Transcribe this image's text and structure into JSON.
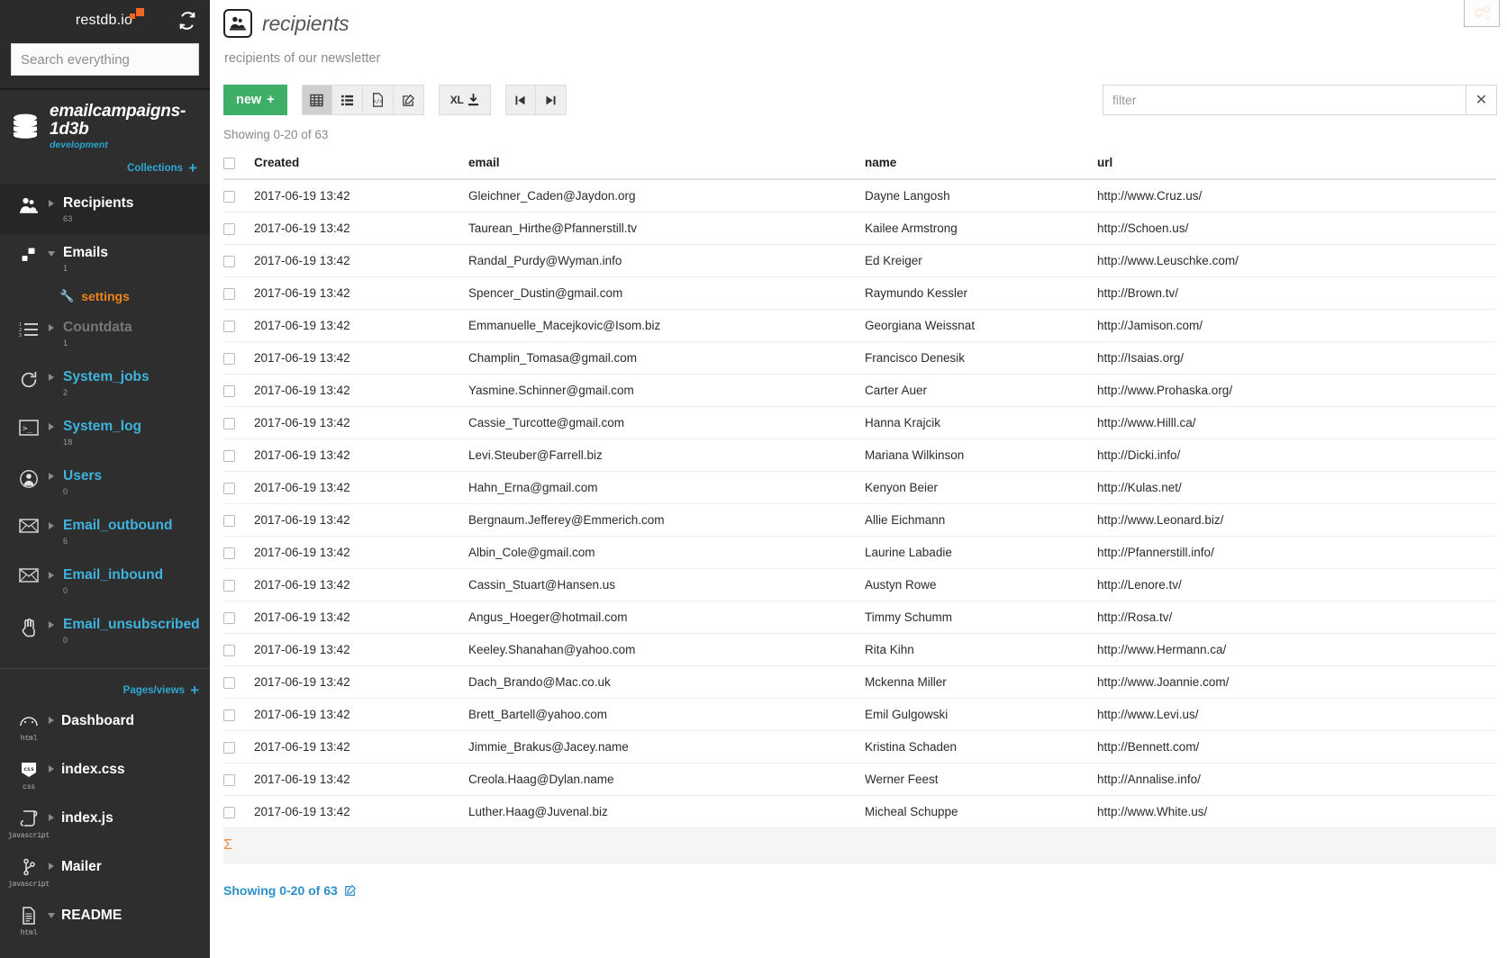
{
  "sidebar": {
    "logo_text": "restdb.io",
    "refresh_icon": "refresh-icon",
    "search": {
      "placeholder": "Search everything",
      "value": ""
    },
    "database": {
      "name": "emailcampaigns-1d3b",
      "environment": "development",
      "collections_label": "Collections",
      "add_symbol": "+"
    },
    "collections": [
      {
        "label": "Recipients",
        "count": "63",
        "color": "white",
        "icon": "recipients-icon",
        "expanded": false,
        "active": true
      },
      {
        "label": "Emails",
        "count": "1",
        "color": "white",
        "icon": "emails-icon",
        "expanded": true,
        "active": false
      },
      {
        "label": "Countdata",
        "count": "1",
        "color": "grey",
        "icon": "list-ordered-icon",
        "expanded": false,
        "active": false
      },
      {
        "label": "System_jobs",
        "count": "2",
        "color": "blue",
        "icon": "refresh-cw-icon",
        "expanded": false,
        "active": false
      },
      {
        "label": "System_log",
        "count": "18",
        "color": "blue",
        "icon": "terminal-icon",
        "expanded": false,
        "active": false
      },
      {
        "label": "Users",
        "count": "0",
        "color": "blue",
        "icon": "user-icon",
        "expanded": false,
        "active": false
      },
      {
        "label": "Email_outbound",
        "count": "6",
        "color": "blue",
        "icon": "envelope-icon",
        "expanded": false,
        "active": false
      },
      {
        "label": "Email_inbound",
        "count": "0",
        "color": "blue",
        "icon": "envelope-icon",
        "expanded": false,
        "active": false
      },
      {
        "label": "Email_unsubscribed",
        "count": "0",
        "color": "blue",
        "icon": "hand-icon",
        "expanded": false,
        "active": false
      }
    ],
    "emails_subitem": {
      "label": "settings",
      "icon": "wrench-icon"
    },
    "pages": {
      "header_label": "Pages/views",
      "add_symbol": "+",
      "items": [
        {
          "label": "Dashboard",
          "type": "html",
          "icon": "gauge-icon",
          "expanded": false
        },
        {
          "label": "index.css",
          "type": "css",
          "icon": "css-icon",
          "expanded": false
        },
        {
          "label": "index.js",
          "type": "javascript",
          "icon": "scroll-icon",
          "expanded": false
        },
        {
          "label": "Mailer",
          "type": "javascript",
          "icon": "branch-icon",
          "expanded": false
        },
        {
          "label": "README",
          "type": "html",
          "icon": "doc-icon",
          "expanded": true
        }
      ]
    }
  },
  "main": {
    "gear_icon": "gears-icon",
    "title": "recipients",
    "title_icon": "recipients-icon",
    "description": "recipients of our newsletter",
    "toolbar": {
      "new_label": "new",
      "new_plus": "+",
      "view_buttons": [
        {
          "icon": "table-view-icon",
          "selected": true
        },
        {
          "icon": "list-view-icon",
          "selected": false
        },
        {
          "icon": "code-view-icon",
          "selected": false
        },
        {
          "icon": "edit-view-icon",
          "selected": false
        }
      ],
      "export_label": "XL",
      "export_icon": "download-icon",
      "first_page_icon": "skip-first-icon",
      "last_page_icon": "skip-last-icon"
    },
    "filter": {
      "placeholder": "filter",
      "value": "",
      "clear_symbol": "✕"
    },
    "showing_top": "Showing 0-20 of 63",
    "footer_link": "Showing 0-20 of 63",
    "footer_icon": "edit-icon",
    "summary_symbol": "Σ",
    "table": {
      "columns": [
        "Created",
        "email",
        "name",
        "url"
      ],
      "rows": [
        {
          "created": "2017-06-19 13:42",
          "email": "Gleichner_Caden@Jaydon.org",
          "name": "Dayne Langosh",
          "url": "http://www.Cruz.us/"
        },
        {
          "created": "2017-06-19 13:42",
          "email": "Taurean_Hirthe@Pfannerstill.tv",
          "name": "Kailee Armstrong",
          "url": "http://Schoen.us/"
        },
        {
          "created": "2017-06-19 13:42",
          "email": "Randal_Purdy@Wyman.info",
          "name": "Ed Kreiger",
          "url": "http://www.Leuschke.com/"
        },
        {
          "created": "2017-06-19 13:42",
          "email": "Spencer_Dustin@gmail.com",
          "name": "Raymundo Kessler",
          "url": "http://Brown.tv/"
        },
        {
          "created": "2017-06-19 13:42",
          "email": "Emmanuelle_Macejkovic@Isom.biz",
          "name": "Georgiana Weissnat",
          "url": "http://Jamison.com/"
        },
        {
          "created": "2017-06-19 13:42",
          "email": "Champlin_Tomasa@gmail.com",
          "name": "Francisco Denesik",
          "url": "http://Isaias.org/"
        },
        {
          "created": "2017-06-19 13:42",
          "email": "Yasmine.Schinner@gmail.com",
          "name": "Carter Auer",
          "url": "http://www.Prohaska.org/"
        },
        {
          "created": "2017-06-19 13:42",
          "email": "Cassie_Turcotte@gmail.com",
          "name": "Hanna Krajcik",
          "url": "http://www.Hilll.ca/"
        },
        {
          "created": "2017-06-19 13:42",
          "email": "Levi.Steuber@Farrell.biz",
          "name": "Mariana Wilkinson",
          "url": "http://Dicki.info/"
        },
        {
          "created": "2017-06-19 13:42",
          "email": "Hahn_Erna@gmail.com",
          "name": "Kenyon Beier",
          "url": "http://Kulas.net/"
        },
        {
          "created": "2017-06-19 13:42",
          "email": "Bergnaum.Jefferey@Emmerich.com",
          "name": "Allie Eichmann",
          "url": "http://www.Leonard.biz/"
        },
        {
          "created": "2017-06-19 13:42",
          "email": "Albin_Cole@gmail.com",
          "name": "Laurine Labadie",
          "url": "http://Pfannerstill.info/"
        },
        {
          "created": "2017-06-19 13:42",
          "email": "Cassin_Stuart@Hansen.us",
          "name": "Austyn Rowe",
          "url": "http://Lenore.tv/"
        },
        {
          "created": "2017-06-19 13:42",
          "email": "Angus_Hoeger@hotmail.com",
          "name": "Timmy Schumm",
          "url": "http://Rosa.tv/"
        },
        {
          "created": "2017-06-19 13:42",
          "email": "Keeley.Shanahan@yahoo.com",
          "name": "Rita Kihn",
          "url": "http://www.Hermann.ca/"
        },
        {
          "created": "2017-06-19 13:42",
          "email": "Dach_Brando@Mac.co.uk",
          "name": "Mckenna Miller",
          "url": "http://www.Joannie.com/"
        },
        {
          "created": "2017-06-19 13:42",
          "email": "Brett_Bartell@yahoo.com",
          "name": "Emil Gulgowski",
          "url": "http://www.Levi.us/"
        },
        {
          "created": "2017-06-19 13:42",
          "email": "Jimmie_Brakus@Jacey.name",
          "name": "Kristina Schaden",
          "url": "http://Bennett.com/"
        },
        {
          "created": "2017-06-19 13:42",
          "email": "Creola.Haag@Dylan.name",
          "name": "Werner Feest",
          "url": "http://Annalise.info/"
        },
        {
          "created": "2017-06-19 13:42",
          "email": "Luther.Haag@Juvenal.biz",
          "name": "Micheal Schuppe",
          "url": "http://www.White.us/"
        }
      ]
    }
  },
  "colors": {
    "sidebar_bg": "#2e2e2e",
    "accent_blue": "#3eb3dd",
    "accent_orange": "#f26522",
    "new_green": "#3fae67",
    "link_blue": "#2c8fc9"
  }
}
